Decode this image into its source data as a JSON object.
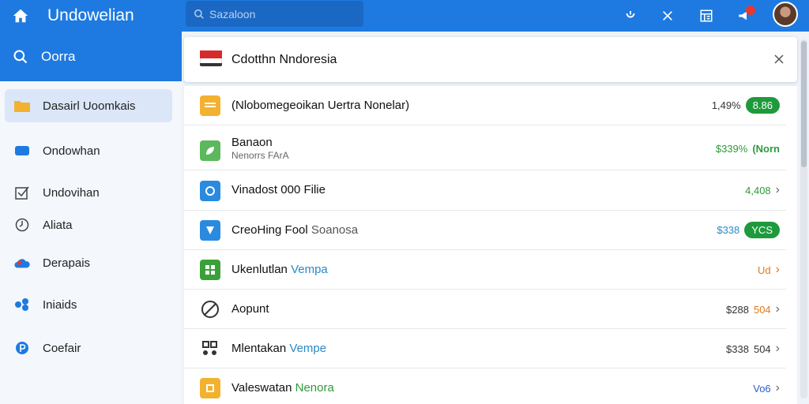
{
  "topbar": {
    "title": "Undowelian",
    "search_placeholder": "Sazaloon"
  },
  "sidebar": {
    "search_label": "Oorra",
    "items": [
      {
        "label": "Dasairl Uoomkais",
        "icon": "folder-icon",
        "active": true
      },
      {
        "label": "Ondowhan",
        "icon": "chat-icon",
        "active": false
      },
      {
        "label": "Undovihan",
        "icon": "checkbox-icon",
        "active": false
      },
      {
        "label": "Aliata",
        "icon": "clock-icon",
        "active": false
      },
      {
        "label": "Derapais",
        "icon": "cloud-icon",
        "active": false
      },
      {
        "label": "Iniaids",
        "icon": "share-icon",
        "active": false
      },
      {
        "label": "Coefair",
        "icon": "p-icon",
        "active": false
      }
    ]
  },
  "header": {
    "title": "Cdotthn Nndoresia"
  },
  "rows": [
    {
      "name": "(Nlobomegeoikan Uertra Nonelar)",
      "sub": "",
      "value": "1,49%",
      "badge": "8.86",
      "badge_color": "#1e9a3c",
      "value_color": "#333",
      "chevron": false,
      "icon": "yellow-folder-icon"
    },
    {
      "name": "Banaon",
      "sub": "Nenorrs FArA",
      "value": "$339%",
      "badge": "(Norn",
      "badge_color": "",
      "value_color": "#2e9a3a",
      "chevron": false,
      "icon": "green-leaf-icon"
    },
    {
      "name": "Vinadost 000 Filie",
      "sub": "",
      "value": "4,408",
      "badge": "",
      "badge_color": "",
      "value_color": "#2e9a3a",
      "chevron": true,
      "icon": "blue-circle-icon"
    },
    {
      "name": "CreoHing Fool",
      "accent": "Soanosa",
      "sub": "",
      "value": "$338",
      "badge": "YCS",
      "badge_color": "#1e9a3c",
      "value_color": "#2a8ac8",
      "chevron": false,
      "icon": "blue-tag-icon"
    },
    {
      "name": "Ukenlutlan",
      "accent": "Vempa",
      "sub": "",
      "value": "Ud",
      "badge": "",
      "badge_color": "",
      "value_color": "#e07a1f",
      "chevron": true,
      "icon": "green-grid-icon"
    },
    {
      "name": "Aopunt",
      "sub": "",
      "value": "$288",
      "badge": "504",
      "badge_color": "",
      "value_color": "#333",
      "chevron": true,
      "icon": "no-sign-icon"
    },
    {
      "name": "Mlentakan",
      "accent": "Vempe",
      "sub": "",
      "value": "$338",
      "badge": "504",
      "badge_color": "",
      "value_color": "#333",
      "chevron": true,
      "icon": "group-icon"
    },
    {
      "name": "Valeswatan",
      "accent_green": "Nenora",
      "sub": "",
      "value": "Vo6",
      "badge": "",
      "badge_color": "",
      "value_color": "#2a62c8",
      "chevron": true,
      "icon": "yellow-square-icon"
    }
  ],
  "colors": {
    "brand": "#1e7ae0",
    "active": "#dbe7f8",
    "green": "#1e9a3c"
  }
}
